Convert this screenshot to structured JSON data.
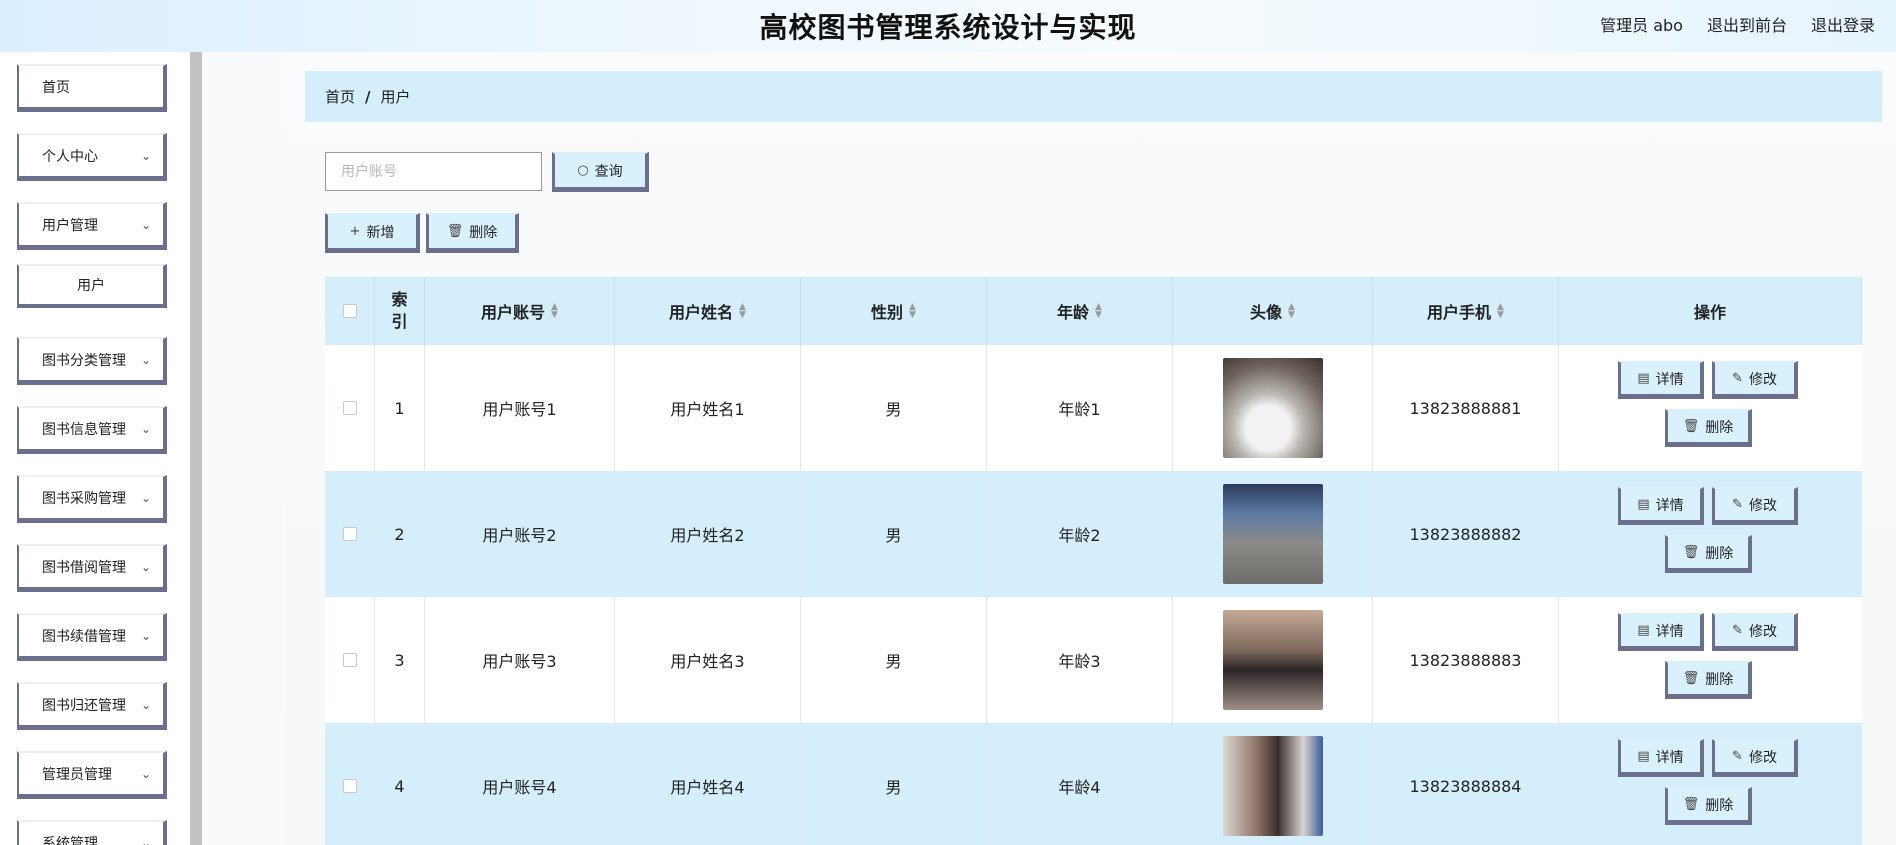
{
  "header": {
    "title": "高校图书管理系统设计与实现",
    "admin_label": "管理员 abo",
    "front_link": "退出到前台",
    "logout_link": "退出登录"
  },
  "sidebar": {
    "items": [
      {
        "label": "首页",
        "has_chevron": false
      },
      {
        "label": "个人中心",
        "has_chevron": true
      },
      {
        "label": "用户管理",
        "has_chevron": true
      },
      {
        "label": "用户",
        "sub": true
      },
      {
        "label": "图书分类管理",
        "has_chevron": true
      },
      {
        "label": "图书信息管理",
        "has_chevron": true
      },
      {
        "label": "图书采购管理",
        "has_chevron": true
      },
      {
        "label": "图书借阅管理",
        "has_chevron": true
      },
      {
        "label": "图书续借管理",
        "has_chevron": true
      },
      {
        "label": "图书归还管理",
        "has_chevron": true
      },
      {
        "label": "管理员管理",
        "has_chevron": true
      },
      {
        "label": "系统管理",
        "has_chevron": true
      }
    ]
  },
  "breadcrumb": {
    "home": "首页",
    "separator": "/",
    "current": "用户"
  },
  "search": {
    "placeholder": "用户账号",
    "button_label": "查询"
  },
  "toolbar": {
    "add_label": "新增",
    "delete_label": "删除"
  },
  "table": {
    "headers": {
      "index": "索\n引",
      "account": "用户账号",
      "name": "用户姓名",
      "gender": "性别",
      "age": "年龄",
      "avatar": "头像",
      "phone": "用户手机",
      "ops": "操作"
    },
    "rows": [
      {
        "index": "1",
        "account": "用户账号1",
        "name": "用户姓名1",
        "gender": "男",
        "age": "年龄1",
        "phone": "13823888881"
      },
      {
        "index": "2",
        "account": "用户账号2",
        "name": "用户姓名2",
        "gender": "男",
        "age": "年龄2",
        "phone": "13823888882"
      },
      {
        "index": "3",
        "account": "用户账号3",
        "name": "用户姓名3",
        "gender": "男",
        "age": "年龄3",
        "phone": "13823888883"
      },
      {
        "index": "4",
        "account": "用户账号4",
        "name": "用户姓名4",
        "gender": "男",
        "age": "年龄4",
        "phone": "13823888884"
      }
    ],
    "row_actions": {
      "detail": "详情",
      "edit": "修改",
      "delete": "删除"
    }
  },
  "colors": {
    "accent_light": "#d4eefb",
    "button_border": "#6b6e8c",
    "sidebar_rail": "#c2c2c2"
  }
}
